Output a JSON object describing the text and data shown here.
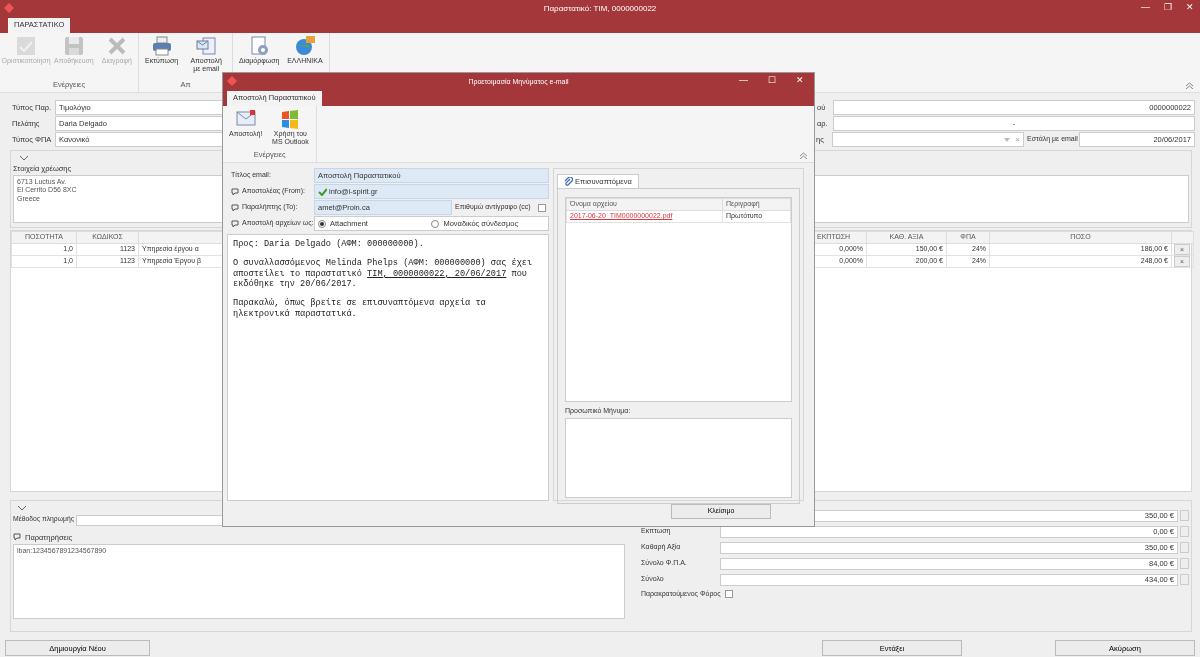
{
  "window": {
    "title": "Παραστατικό: TIM, 0000000022",
    "controls": [
      "—",
      "❐",
      "✕"
    ]
  },
  "ribbon": {
    "tabs": [
      {
        "label": "ΠΑΡΑΣΤΑΤΙΚΟ",
        "selected": true
      }
    ],
    "groups": [
      {
        "label": "Ενέργειες",
        "buttons": [
          {
            "label": "Οριστικοποίηση",
            "disabled": true
          },
          {
            "label": "Αποθήκευση",
            "disabled": true
          },
          {
            "label": "Διαγραφή",
            "disabled": true
          }
        ]
      },
      {
        "label": "Απ",
        "buttons": [
          {
            "label": "Εκτύπωση",
            "disabled": false
          },
          {
            "label": "Αποστολή με email",
            "disabled": false
          }
        ]
      },
      {
        "buttons": [
          {
            "label": "Διαμόρφωση",
            "disabled": false
          },
          {
            "label": "ΕΛΛΗΝΙΚΑ",
            "disabled": false
          }
        ]
      }
    ]
  },
  "header_fields": {
    "left": [
      {
        "label": "Τύπος Παρ.",
        "value": "Τιμολόγιο"
      },
      {
        "label": "Πελάτης",
        "value": "Daria Delgado"
      },
      {
        "label": "Τύπος ΦΠΑ",
        "value": "Κανονικό"
      }
    ],
    "right": [
      {
        "label": "ού",
        "kind": "text",
        "value": "0000000022"
      },
      {
        "label": "αρ.",
        "kind": "center",
        "value": "-"
      },
      {
        "label": "ης",
        "kind": "dropdown",
        "clear": "×"
      }
    ],
    "sent_by_email": {
      "label": "Εστάλη με email",
      "value": "20/06/2017"
    }
  },
  "billing": {
    "label": "Στοιχεία χρέωσης",
    "expanded": true,
    "address": [
      "6713 Luctus Av.",
      "El Cerrito D56 8XC",
      "Greece"
    ]
  },
  "table": {
    "columns": [
      "ΠΟΣΟΤΗΤΑ",
      "ΚΩΔΙΚΟΣ",
      "",
      "ΕΚΠΤΩΣΗ",
      "ΚΑΘ. ΑΞΙΑ",
      "ΦΠΑ",
      "ΠΟΣΟ"
    ],
    "rows": [
      {
        "cells": [
          "1,0",
          "1123",
          "Υπηρεσία έργου α",
          "0,000%",
          "150,00 €",
          "24%",
          "186,00 €"
        ],
        "delete": "×"
      },
      {
        "cells": [
          "1,0",
          "1123",
          "Υπηρεσία Έργου β",
          "0,000%",
          "200,00 €",
          "24%",
          "248,00 €"
        ],
        "delete": "×"
      }
    ]
  },
  "summary": {
    "expanded": true,
    "payment_method_label": "Μέθοδος πληρωμής",
    "subtotal": "350,00 €",
    "notes_label": "Παρατηρήσεις",
    "notes": "iban:1234567891234567890",
    "totals": [
      {
        "label": "Εκπτωση",
        "value": "0,00 €"
      },
      {
        "label": "Καθαρή Αξία",
        "value": "350,00 €"
      },
      {
        "label": "Σύνολο Φ.Π.Α.",
        "value": "84,00 €"
      },
      {
        "label": "Σύνολο",
        "value": "434,00 €"
      }
    ],
    "withholding": {
      "label": "Παρακρατούμενος Φόρος",
      "checked": false
    }
  },
  "footer_buttons": [
    "Δημιουργία Νέου",
    "Εντάξει",
    "Ακύρωση"
  ],
  "dialog": {
    "title": "Προετοιμασία Μηνύματος e-mail",
    "controls": [
      "—",
      "☐",
      "✕"
    ],
    "tabs": [
      {
        "label": "Αποστολή Παραστατικού",
        "selected": true
      }
    ],
    "group": {
      "label": "Ενέργειες",
      "buttons": [
        {
          "label": "Αποστολή!"
        },
        {
          "label": "Χρήση του MS Outlook"
        }
      ]
    },
    "fields": {
      "title": {
        "label": "Τίτλος email:",
        "value": "Αποστολή Παραστατικού"
      },
      "from": {
        "label": "Αποστολέας (From):",
        "value": "info@i-spirit.gr",
        "verified": true
      },
      "to": {
        "label": "Παραλήπτης (To):",
        "value": "amet@Proin.ca"
      },
      "cc": {
        "label": "Επιθυμώ αντίγραφο (cc)",
        "checked": false
      },
      "send_as": {
        "label": "Αποστολή αρχείων ως:",
        "options": [
          {
            "label": "Attachment",
            "selected": true
          },
          {
            "label": "Μοναδικός σύνδεσμος",
            "selected": false
          }
        ]
      }
    },
    "body": [
      {
        "text": "Προς: Daria Delgado (ΑΦΜ: 000000000)."
      },
      {
        "text": "Ο συναλλασσόμενος Melinda Phelps (ΑΦΜ: 000000000) σας έχει αποστείλει το παραστατικό ",
        "link": "ΤΙΜ, 0000000022, 20/06/2017",
        "after": " που εκδόθηκε την 20/06/2017."
      },
      {
        "text": "Παρακαλώ, όπως βρείτε σε επισυναπτόμενα αρχεία τα ηλεκτρονικά παραστατικά."
      }
    ],
    "attachments": {
      "tab": {
        "label": "Επισυναπτόμενα",
        "selected": true
      },
      "columns": [
        "Όνομα αρχείου",
        "Περιγραφή"
      ],
      "rows": [
        {
          "file": "2017-06-20_TIM0000000022.pdf",
          "description": "Πρωτότυπο"
        }
      ],
      "personal_message_label": "Προσωπικό Μήνυμα:"
    },
    "close_button": "Κλείσιμο"
  }
}
